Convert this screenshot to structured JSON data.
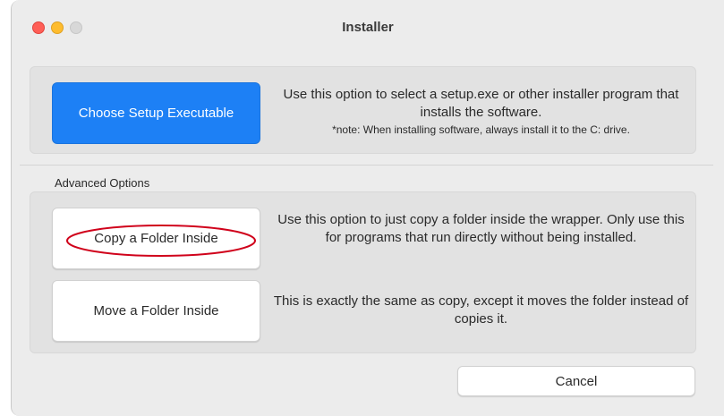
{
  "window": {
    "title": "Installer"
  },
  "setup": {
    "button_label": "Choose Setup Executable",
    "description": "Use this option to select a setup.exe or other installer program that installs the software.",
    "note": "*note: When installing software, always install it to the C: drive."
  },
  "advanced": {
    "section_label": "Advanced Options",
    "copy": {
      "button_label": "Copy a Folder Inside",
      "description": "Use this option to just copy a folder inside the wrapper. Only use this for programs that run directly without being installed."
    },
    "move": {
      "button_label": "Move a Folder Inside",
      "description": "This is exactly the same as copy, except it moves the folder instead of copies it."
    }
  },
  "footer": {
    "cancel_label": "Cancel"
  },
  "colors": {
    "accent": "#1d80f5",
    "annotation": "#d0021b",
    "close": "#ff5f57",
    "minimize": "#febc2e",
    "zoom_inactive": "#d8d8d8"
  }
}
